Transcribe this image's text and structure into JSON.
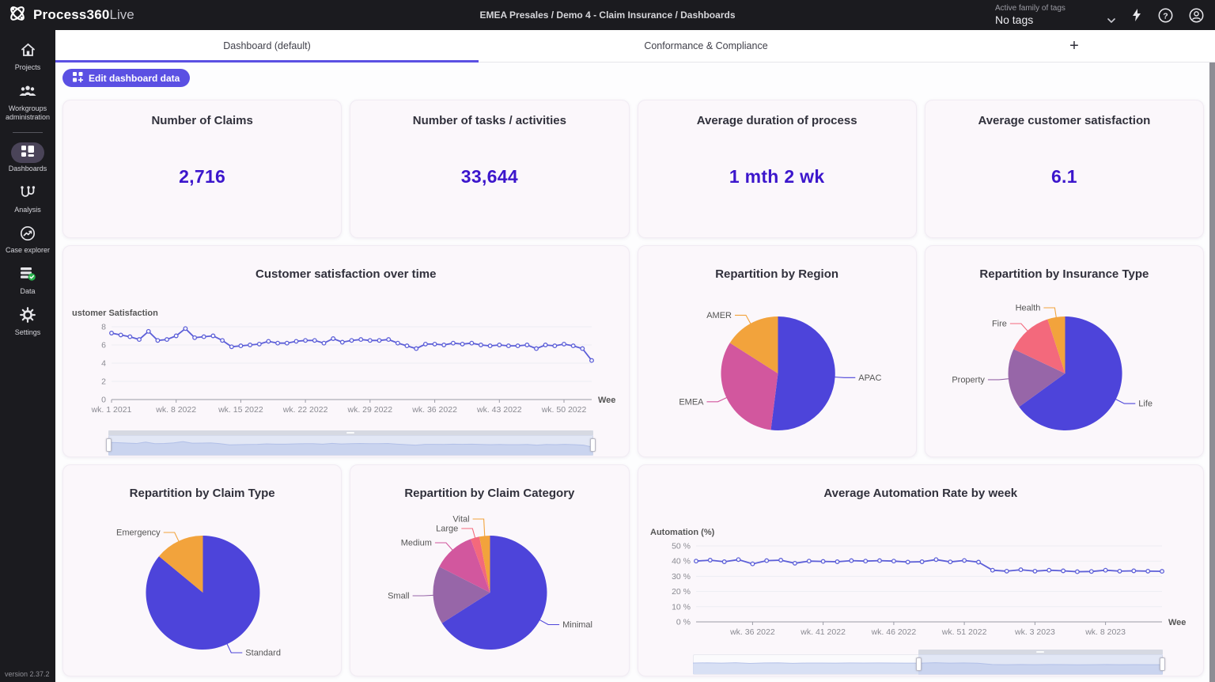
{
  "topbar": {
    "logo_bold": "Process360",
    "logo_light": "Live",
    "breadcrumb": "EMEA Presales / Demo 4 - Claim Insurance / Dashboards",
    "tags_label": "Active family of tags",
    "tags_value": "No tags"
  },
  "sidebar": {
    "items": [
      {
        "label": "Projects"
      },
      {
        "label": "Workgroups administration"
      },
      {
        "label": "Dashboards"
      },
      {
        "label": "Analysis"
      },
      {
        "label": "Case explorer"
      },
      {
        "label": "Data"
      },
      {
        "label": "Settings"
      }
    ],
    "version": "version 2.37.2"
  },
  "tabbar": {
    "tabs": [
      {
        "label": "Dashboard (default)"
      },
      {
        "label": "Conformance & Compliance"
      }
    ],
    "add": "+"
  },
  "toolbar": {
    "edit_button": "Edit dashboard data"
  },
  "kpis": [
    {
      "title": "Number of Claims",
      "value": "2,716"
    },
    {
      "title": "Number of tasks / activities",
      "value": "33,644"
    },
    {
      "title": "Average duration of process",
      "value": "1 mth 2 wk"
    },
    {
      "title": "Average customer satisfaction",
      "value": "6.1"
    }
  ],
  "colors": {
    "accent_purple": "#5b50e3",
    "kpi_value": "#3c16cc",
    "series_line": "#5d5fd8",
    "pie_blue": "#4d44da",
    "pie_pink": "#d2579e",
    "pie_orange": "#f2a33c",
    "pie_salmon": "#f3697c",
    "pie_violet": "#9766a8"
  },
  "chart_data": [
    {
      "id": "satisfaction",
      "type": "line",
      "title": "Customer satisfaction over time",
      "ylabel": "ustomer Satisfaction",
      "xlabel": "Wee",
      "color": "#5d5fd8",
      "ymax": 8,
      "ylim": [
        0,
        8
      ],
      "yticks": [
        {
          "label": "0",
          "value": 0
        },
        {
          "label": "2",
          "value": 2
        },
        {
          "label": "4",
          "value": 4
        },
        {
          "label": "6",
          "value": 6
        },
        {
          "label": "8",
          "value": 8
        }
      ],
      "xticks": [
        {
          "label": "wk. 1 2021",
          "i": 0
        },
        {
          "label": "wk. 8 2022",
          "i": 7
        },
        {
          "label": "wk. 15 2022",
          "i": 14
        },
        {
          "label": "wk. 22 2022",
          "i": 21
        },
        {
          "label": "wk. 29 2022",
          "i": 28
        },
        {
          "label": "wk. 36 2022",
          "i": 35
        },
        {
          "label": "wk. 43 2022",
          "i": 42
        },
        {
          "label": "wk. 50 2022",
          "i": 49
        }
      ],
      "values": [
        7.3,
        7.1,
        6.9,
        6.6,
        7.5,
        6.5,
        6.6,
        7.0,
        7.8,
        6.8,
        6.9,
        7.0,
        6.5,
        5.8,
        5.9,
        6.0,
        6.1,
        6.4,
        6.2,
        6.2,
        6.4,
        6.5,
        6.5,
        6.2,
        6.7,
        6.3,
        6.5,
        6.6,
        6.5,
        6.5,
        6.6,
        6.2,
        5.9,
        5.6,
        6.1,
        6.1,
        6.0,
        6.2,
        6.1,
        6.2,
        6.0,
        5.9,
        6.0,
        5.9,
        5.9,
        6.0,
        5.6,
        6.0,
        5.9,
        6.1,
        5.9,
        5.6,
        4.3
      ],
      "brush": {
        "start_pct": 0,
        "end_pct": 100
      }
    },
    {
      "id": "region",
      "type": "pie",
      "title": "Repartition by Region",
      "slices": [
        {
          "label": "APAC",
          "value": 52,
          "color": "#4d44da"
        },
        {
          "label": "EMEA",
          "value": 32,
          "color": "#d2579e"
        },
        {
          "label": "AMER",
          "value": 16,
          "color": "#f2a33c"
        }
      ]
    },
    {
      "id": "insurance",
      "type": "pie",
      "title": "Repartition by Insurance Type",
      "slices": [
        {
          "label": "Life",
          "value": 65,
          "color": "#4d44da"
        },
        {
          "label": "Property",
          "value": 17,
          "color": "#9766a8"
        },
        {
          "label": "Fire",
          "value": 13,
          "color": "#f3697c"
        },
        {
          "label": "Health",
          "value": 5,
          "color": "#f2a33c"
        }
      ]
    },
    {
      "id": "claim-type",
      "type": "pie",
      "title": "Repartition by Claim Type",
      "slices": [
        {
          "label": "Standard",
          "value": 86,
          "color": "#4d44da"
        },
        {
          "label": "Emergency",
          "value": 14,
          "color": "#f2a33c"
        }
      ]
    },
    {
      "id": "claim-category",
      "type": "pie",
      "title": "Repartition by Claim Category",
      "slices": [
        {
          "label": "Minimal",
          "value": 66,
          "color": "#4d44da"
        },
        {
          "label": "Small",
          "value": 16.5,
          "color": "#9766a8"
        },
        {
          "label": "Medium",
          "value": 12,
          "color": "#d2579e"
        },
        {
          "label": "Large",
          "value": 2.5,
          "color": "#f3697c"
        },
        {
          "label": "Vital",
          "value": 3,
          "color": "#f2a33c"
        }
      ]
    },
    {
      "id": "automation",
      "type": "line",
      "title": "Average Automation Rate by week",
      "ylabel": "Automation (%)",
      "xlabel": "Wee",
      "color": "#5d5fd8",
      "ymax": 50,
      "ylim": [
        0,
        50
      ],
      "yticks": [
        {
          "label": "0 %",
          "value": 0
        },
        {
          "label": "10 %",
          "value": 10
        },
        {
          "label": "20 %",
          "value": 20
        },
        {
          "label": "30 %",
          "value": 30
        },
        {
          "label": "40 %",
          "value": 40
        },
        {
          "label": "50 %",
          "value": 50
        }
      ],
      "xticks": [
        {
          "label": "wk. 36 2022",
          "i": 4
        },
        {
          "label": "wk. 41 2022",
          "i": 9
        },
        {
          "label": "wk. 46 2022",
          "i": 14
        },
        {
          "label": "wk. 51 2022",
          "i": 19
        },
        {
          "label": "wk. 3 2023",
          "i": 24
        },
        {
          "label": "wk. 8 2023",
          "i": 29
        }
      ],
      "values": [
        40.0,
        40.6,
        39.6,
        41.0,
        38.2,
        40.3,
        40.6,
        38.6,
        40.0,
        39.8,
        39.6,
        40.3,
        40.0,
        40.3,
        40.0,
        39.4,
        39.6,
        41.0,
        39.5,
        40.4,
        39.3,
        34.0,
        33.4,
        34.3,
        33.4,
        34.0,
        33.6,
        33.0,
        33.2,
        34.0,
        33.4,
        33.6,
        33.4,
        33.3
      ],
      "brush": {
        "start_pct": 48,
        "end_pct": 100
      }
    }
  ]
}
